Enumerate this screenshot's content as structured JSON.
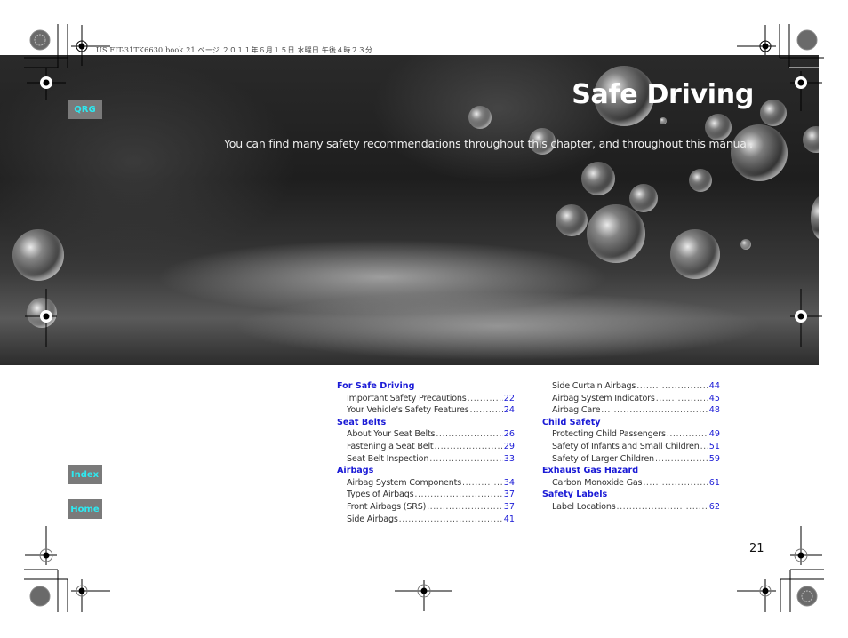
{
  "header_meta": "US FIT-31TK6630.book  21 ページ  ２０１１年６月１５日  水曜日  午後４時２３分",
  "chapter": {
    "title": "Safe Driving",
    "subtitle": "You can find many safety recommendations throughout this chapter, and throughout this manual."
  },
  "nav": {
    "qrg": "QRG",
    "index": "Index",
    "home": "Home",
    "tab_color": "#7a7a7a",
    "tab_text_color": "#2ee8f0"
  },
  "toc": {
    "link_color": "#1a1ad6",
    "left": [
      {
        "section": "For Safe Driving",
        "entries": [
          {
            "title": "Important Safety Precautions",
            "page": "22"
          },
          {
            "title": "Your Vehicle's Safety Features",
            "page": "24"
          }
        ]
      },
      {
        "section": "Seat Belts",
        "entries": [
          {
            "title": "About Your Seat Belts",
            "page": "26"
          },
          {
            "title": "Fastening a Seat Belt",
            "page": "29"
          },
          {
            "title": "Seat Belt Inspection",
            "page": "33"
          }
        ]
      },
      {
        "section": "Airbags",
        "entries": [
          {
            "title": "Airbag System Components",
            "page": "34"
          },
          {
            "title": "Types of Airbags",
            "page": "37"
          },
          {
            "title": "Front Airbags (SRS)",
            "page": "37"
          },
          {
            "title": "Side Airbags",
            "page": "41"
          }
        ]
      }
    ],
    "right": [
      {
        "section": "",
        "entries": [
          {
            "title": "Side Curtain Airbags",
            "page": "44"
          },
          {
            "title": "Airbag System Indicators",
            "page": "45"
          },
          {
            "title": "Airbag Care",
            "page": "48"
          }
        ]
      },
      {
        "section": "Child Safety",
        "entries": [
          {
            "title": "Protecting Child Passengers",
            "page": "49"
          },
          {
            "title": "Safety of Infants and Small Children",
            "page": "51"
          },
          {
            "title": "Safety of Larger Children",
            "page": "59"
          }
        ]
      },
      {
        "section": "Exhaust Gas Hazard",
        "entries": [
          {
            "title": "Carbon Monoxide Gas",
            "page": "61"
          }
        ]
      },
      {
        "section": "Safety Labels",
        "entries": [
          {
            "title": "Label Locations",
            "page": "62"
          }
        ]
      }
    ]
  },
  "page_number": "21"
}
